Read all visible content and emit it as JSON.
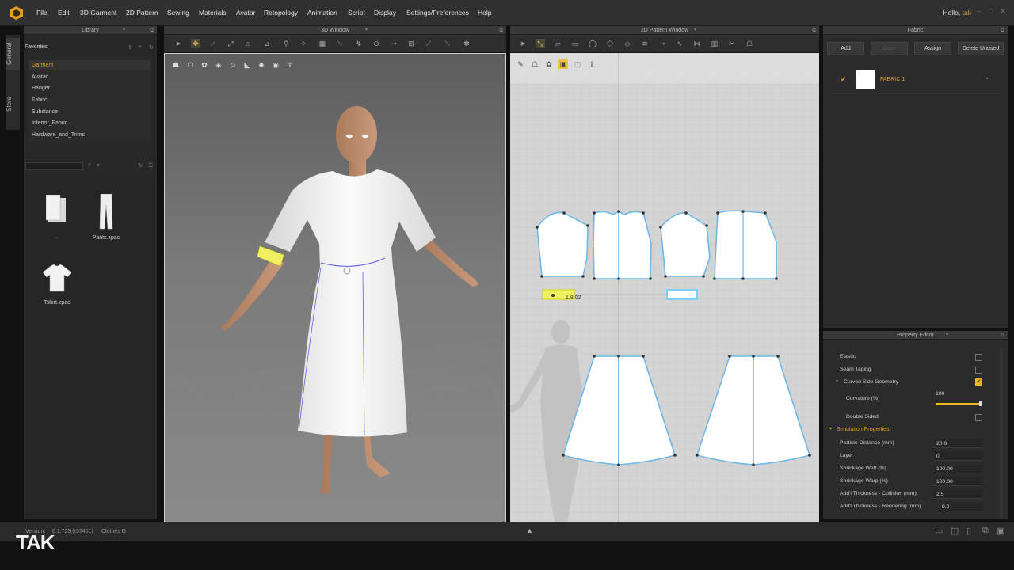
{
  "menu": [
    "File",
    "Edit",
    "3D Garment",
    "2D Pattern",
    "Sewing",
    "Materials",
    "Avatar",
    "Retopology",
    "Animation",
    "Script",
    "Display",
    "Settings/Preferences",
    "Help"
  ],
  "user": {
    "greeting": "Hello,",
    "name": "tak"
  },
  "sidetabs": {
    "general": "General",
    "store": "Store"
  },
  "panels": {
    "library": "Library",
    "window3d": "3D Window",
    "window2d": "2D Pattern Window",
    "fabric": "Fabric",
    "property_editor": "Property Editor"
  },
  "library": {
    "favorites_title": "Favorites",
    "favorites": [
      "Garment",
      "Avatar",
      "Hanger",
      "Fabric",
      "Substance",
      "Interior_Fabric",
      "Hardware_and_Trims"
    ],
    "files": [
      {
        "name": "..",
        "icon": "folder-up-icon"
      },
      {
        "name": "Pants.zpac",
        "icon": "pants-icon"
      },
      {
        "name": "Tshirt.zpac",
        "icon": "tshirt-icon"
      }
    ]
  },
  "pattern_window": {
    "measure_label": "1.8:02"
  },
  "fabric": {
    "buttons": {
      "add": "Add",
      "copy": "Copy",
      "assign": "Assign",
      "delete_unused": "Delete Unused"
    },
    "items": [
      {
        "name": "FABRIC 1",
        "checked": true
      }
    ]
  },
  "properties": {
    "rows": [
      {
        "label": "Elastic",
        "type": "checkbox",
        "checked": false
      },
      {
        "label": "Seam Taping",
        "type": "checkbox",
        "checked": false
      },
      {
        "label": "Curved Side Geometry",
        "type": "checkbox",
        "checked": true
      },
      {
        "label": "Curvature (%)",
        "type": "slider",
        "value": "100",
        "fraction": 1.0
      },
      {
        "label": "Double Sided",
        "type": "checkbox",
        "checked": false
      }
    ],
    "section": "Simulation Properties",
    "sim": [
      {
        "label": "Particle Distance (mm)",
        "value": "20.0"
      },
      {
        "label": "Layer",
        "value": "0"
      },
      {
        "label": "Shrinkage Weft (%)",
        "value": "100.00"
      },
      {
        "label": "Shrinkage Warp (%)",
        "value": "100.00"
      },
      {
        "label": "Add'l Thickness - Collision (mm)",
        "value": "2.5"
      },
      {
        "label": "Add'l Thickness - Rendering (mm)",
        "value": "0.0"
      }
    ]
  },
  "status": {
    "version_label": "Version:",
    "version": "6.1.723 (r37401)",
    "extra": "Clothes G"
  },
  "watermark": "TAK",
  "colors": {
    "accent": "#e0a020",
    "highlight": "#f0e040",
    "selected_outline": "#6fb8e8"
  }
}
